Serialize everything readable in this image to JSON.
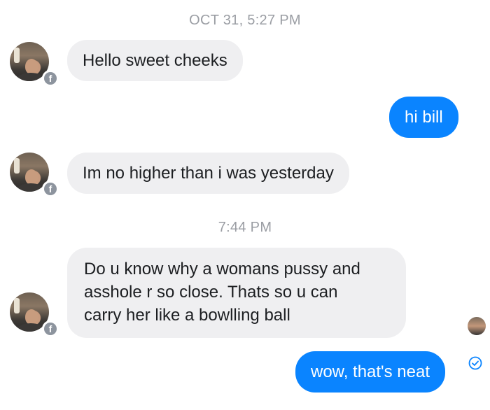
{
  "timestamps": [
    "OCT 31, 5:27 PM",
    "7:44 PM"
  ],
  "messages": [
    {
      "text": "Hello sweet cheeks"
    },
    {
      "text": "hi bill"
    },
    {
      "text": "Im no higher than i was yesterday"
    },
    {
      "text": "Do u know why a womans pussy and\nasshole r so close. Thats so u can\ncarry her like a bowlling ball"
    },
    {
      "text": "wow, that's neat"
    }
  ],
  "badge_glyph": "f",
  "colors": {
    "outgoing_bubble": "#0a84ff",
    "incoming_bubble": "#efeff1",
    "timestamp": "#9a9da3"
  },
  "icons": {
    "avatar": "person-photo-icon",
    "badge": "facebook-badge-icon",
    "delivered": "check-circle-icon"
  }
}
